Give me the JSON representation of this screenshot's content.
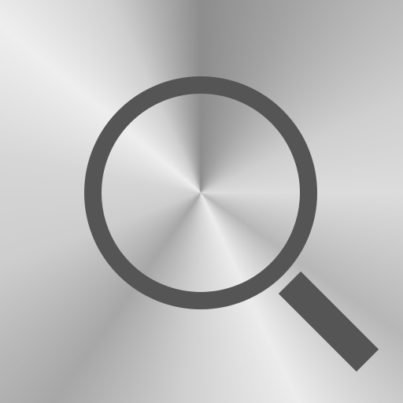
{
  "icon": {
    "name": "magnifying-glass",
    "glyph_color": "#555555",
    "background": "brushed-metal"
  }
}
